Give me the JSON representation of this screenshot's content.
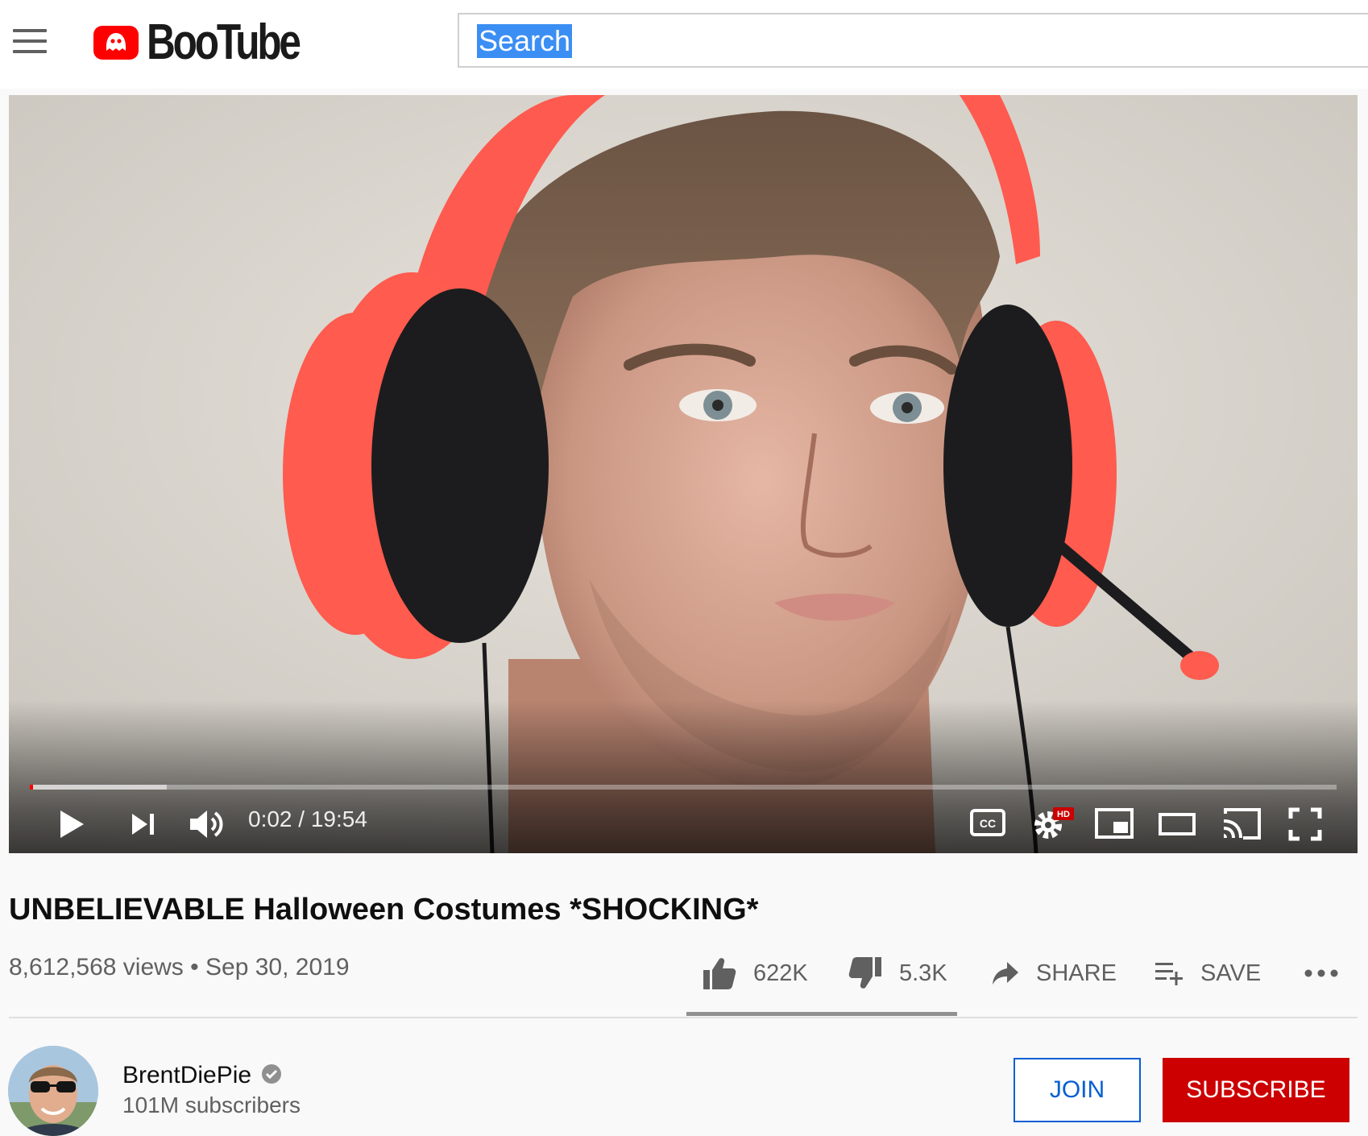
{
  "app": {
    "name": "BooTube",
    "brand_color": "#ff0000"
  },
  "search": {
    "value": "Search",
    "selected_text": "Search"
  },
  "player": {
    "current_time": "0:02",
    "duration": "19:54",
    "time_display": "0:02 / 19:54",
    "played_fraction": 0.002,
    "buffered_fraction": 0.105,
    "hd_badge": "HD",
    "cc_label": "CC"
  },
  "video": {
    "title": "UNBELIEVABLE Halloween Costumes *SHOCKING*",
    "views": "8,612,568 views",
    "separator": "•",
    "date": "Sep 30, 2019",
    "meta_line": "8,612,568 views • Sep 30, 2019"
  },
  "actions": {
    "likes": "622K",
    "dislikes": "5.3K",
    "share": "SHARE",
    "save": "SAVE",
    "like_ratio": 0.992
  },
  "channel": {
    "name": "BrentDiePie",
    "subscribers": "101M subscribers",
    "join_label": "JOIN",
    "subscribe_label": "SUBSCRIBE"
  },
  "icons": [
    "menu-icon",
    "logo-icon",
    "play-icon",
    "next-icon",
    "volume-icon",
    "cc-icon",
    "settings-icon",
    "miniplayer-icon",
    "theater-icon",
    "cast-icon",
    "fullscreen-icon",
    "thumbs-up-icon",
    "thumbs-down-icon",
    "share-icon",
    "playlist-add-icon",
    "more-icon",
    "verified-icon"
  ]
}
